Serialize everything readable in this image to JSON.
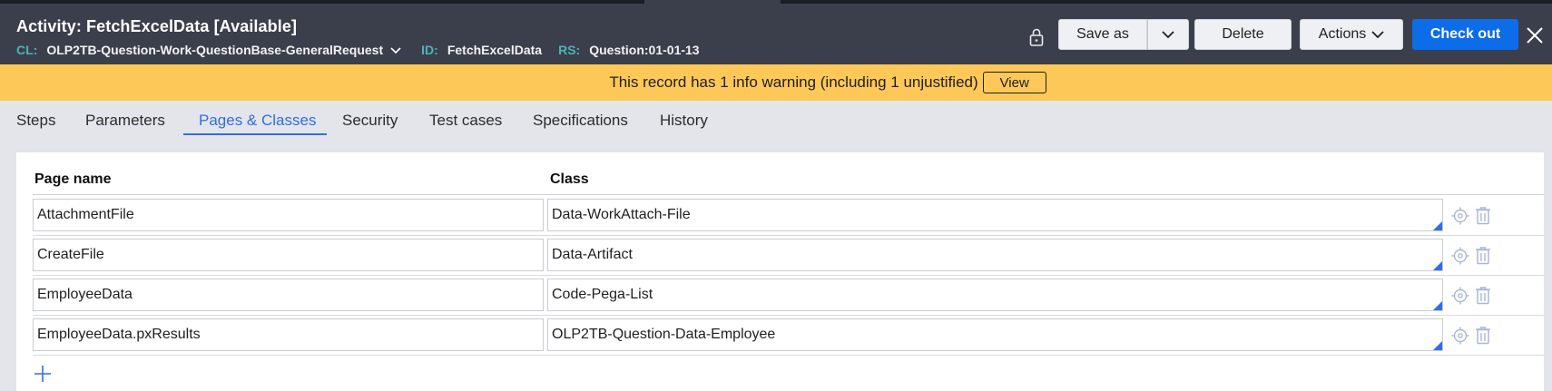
{
  "header": {
    "title": "Activity: FetchExcelData [Available]",
    "cl_label": "CL:",
    "cl_value": "OLP2TB-Question-Work-QuestionBase-GeneralRequest",
    "id_label": "ID:",
    "id_value": "FetchExcelData",
    "rs_label": "RS:",
    "rs_value": "Question:01-01-13",
    "save_as": "Save as",
    "delete": "Delete",
    "actions": "Actions",
    "check_out": "Check out"
  },
  "banner": {
    "text": "This record has 1 info warning (including 1 unjustified)",
    "view": "View"
  },
  "tabs": [
    {
      "label": "Steps"
    },
    {
      "label": "Parameters"
    },
    {
      "label": "Pages & Classes",
      "active": true
    },
    {
      "label": "Security"
    },
    {
      "label": "Test cases"
    },
    {
      "label": "Specifications"
    },
    {
      "label": "History"
    }
  ],
  "table": {
    "headers": {
      "page_name": "Page name",
      "class": "Class"
    },
    "rows": [
      {
        "page_name": "AttachmentFile",
        "class": "Data-WorkAttach-File"
      },
      {
        "page_name": "CreateFile",
        "class": "Data-Artifact"
      },
      {
        "page_name": "EmployeeData",
        "class": "Code-Pega-List"
      },
      {
        "page_name": "EmployeeData.pxResults",
        "class": "OLP2TB-Question-Data-Employee"
      }
    ]
  },
  "icons": {
    "lock": "lock-icon",
    "close": "close-icon",
    "row_locate": "locate-icon",
    "row_delete": "trash-icon",
    "add_row": "plus-icon"
  },
  "colors": {
    "header_bg": "#3b3f4c",
    "banner_bg": "#fec858",
    "accent": "#2f6ee6",
    "primary_button": "#0d6ce8",
    "meta_key": "#4fb3b6"
  }
}
